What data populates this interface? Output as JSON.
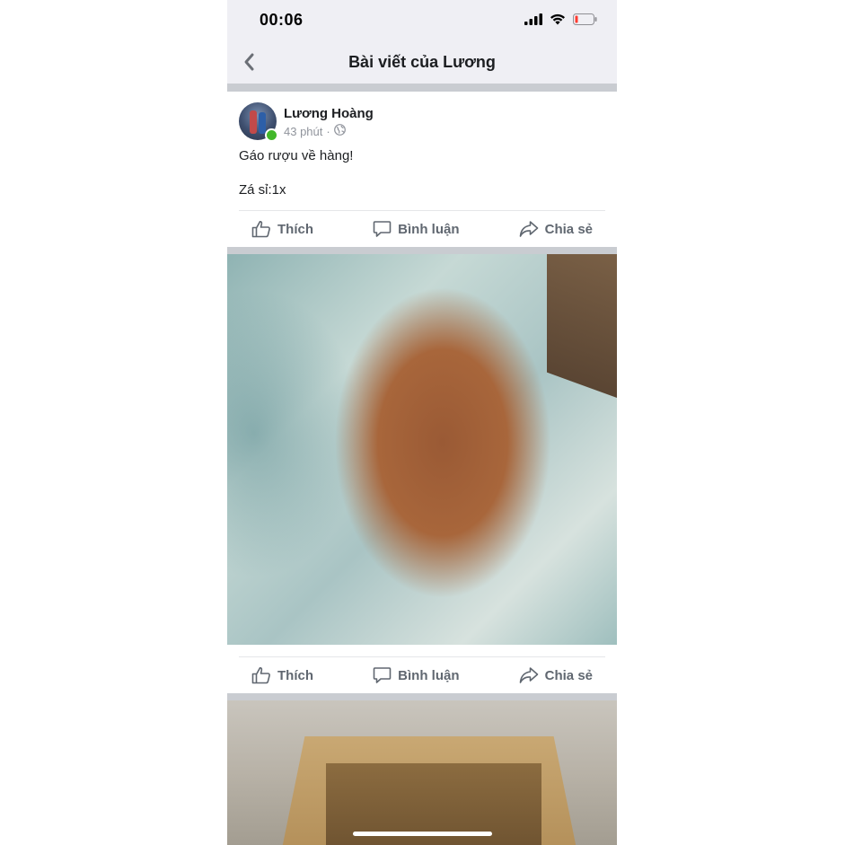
{
  "status_bar": {
    "time": "00:06"
  },
  "nav": {
    "title": "Bài viết của Lương"
  },
  "post": {
    "author": "Lương Hoàng",
    "time_ago": "43 phút",
    "separator": "·",
    "line1": "Gáo rượu về hàng!",
    "line2": "Zá sỉ:1x"
  },
  "actions": {
    "like": "Thích",
    "comment": "Bình luận",
    "share": "Chia sẻ"
  },
  "colors": {
    "bar_bg": "#efeff4",
    "online": "#42b72a",
    "action_text": "#606770"
  },
  "icons": [
    "back-chevron-icon",
    "signal-icon",
    "wifi-icon",
    "battery-icon",
    "globe-icon",
    "like-icon",
    "comment-icon",
    "share-icon"
  ]
}
